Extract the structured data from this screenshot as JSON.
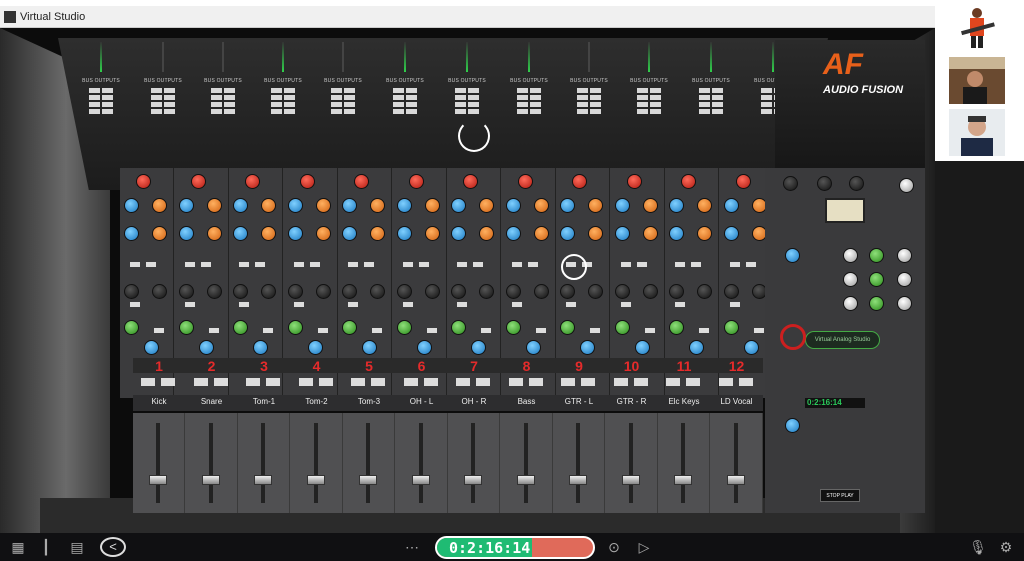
{
  "window": {
    "title": "Virtual Studio"
  },
  "console": {
    "brand_logo": "AF",
    "brand_name": "AUDIO FUSION",
    "bus_label": "BUS OUTPUTS",
    "channel_numbers": [
      "1",
      "2",
      "3",
      "4",
      "5",
      "6",
      "7",
      "8",
      "9",
      "10",
      "11",
      "12"
    ],
    "channel_names": [
      "Kick",
      "Snare",
      "Tom-1",
      "Tom-2",
      "Tom-3",
      "OH - L",
      "OH - R",
      "Bass",
      "GTR - L",
      "GTR - R",
      "Elc Keys",
      "LD Vocal"
    ],
    "master": {
      "badge": "Virtual Analog Studio",
      "time": "0:2:16:14",
      "stop_label": "STOP",
      "play_label": "PLAY"
    }
  },
  "toolbar": {
    "time": "0:2:16:14",
    "progress_fraction": 0.61,
    "back_glyph": "<",
    "menu_glyph": "⋯"
  },
  "colors": {
    "accent_green": "#1fbb73",
    "accent_red": "#e06a5a",
    "channel_number": "#e52b2b"
  }
}
